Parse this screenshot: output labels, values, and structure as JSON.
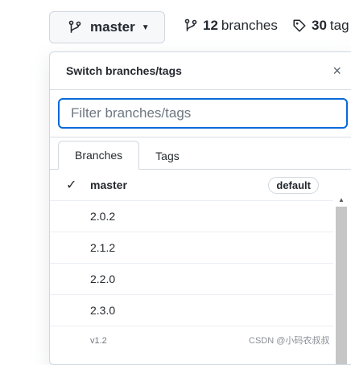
{
  "toolbar": {
    "branch_button_label": "master",
    "branches_count": "12",
    "branches_label": "branches",
    "tags_count": "30",
    "tags_label": "tag"
  },
  "dropdown": {
    "title": "Switch branches/tags",
    "close_icon": "×",
    "filter_placeholder": "Filter branches/tags",
    "filter_value": "",
    "tabs": [
      {
        "label": "Branches",
        "active": true
      },
      {
        "label": "Tags",
        "active": false
      }
    ],
    "rows": [
      {
        "label": "master",
        "checked": true,
        "badge": "default"
      },
      {
        "label": "2.0.2"
      },
      {
        "label": "2.1.2"
      },
      {
        "label": "2.2.0"
      },
      {
        "label": "2.3.0"
      },
      {
        "label": "v1.2"
      }
    ]
  },
  "icons": {
    "branch": "git-branch-icon",
    "tag": "tag-icon",
    "check": "check-icon",
    "close": "close-icon",
    "caret": "caret-down-icon"
  },
  "watermark": "CSDN @小码农叔叔",
  "colors": {
    "accent": "#0969da",
    "border": "#d0d7de",
    "button_bg": "#f6f8fa"
  }
}
